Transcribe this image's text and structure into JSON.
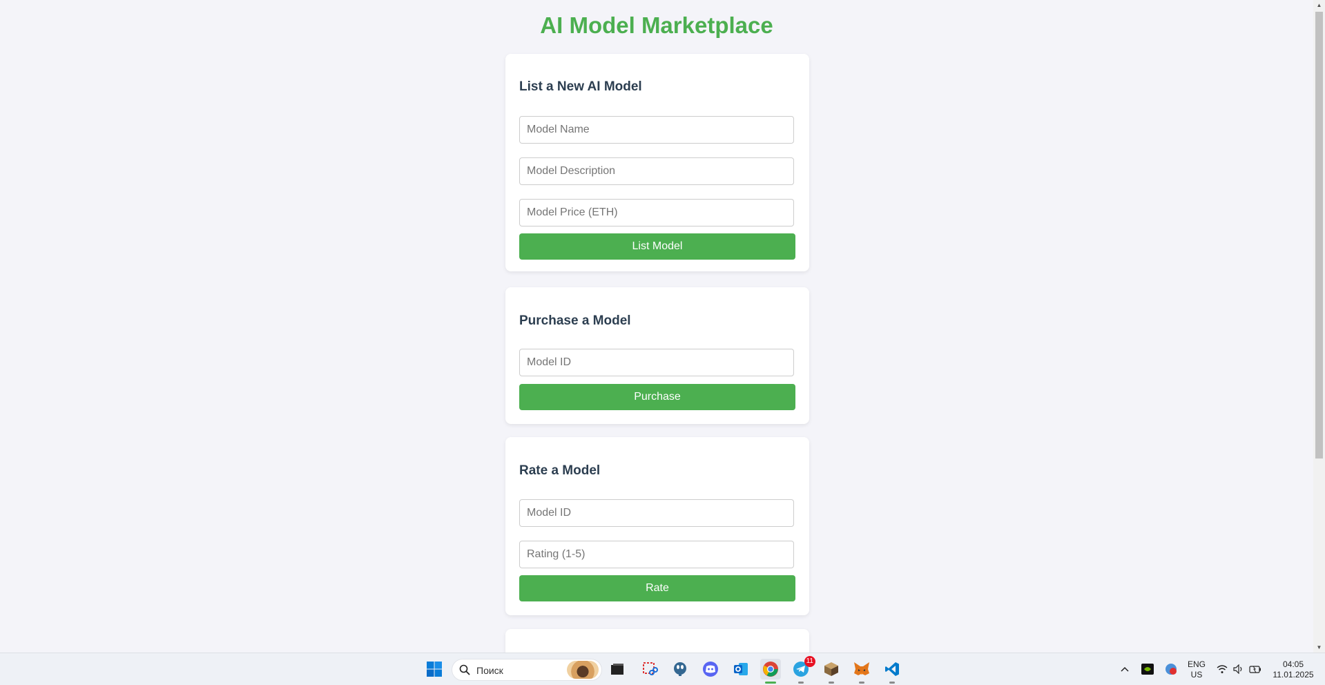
{
  "page": {
    "title": "AI Model Marketplace"
  },
  "list_card": {
    "heading": "List a New AI Model",
    "name_placeholder": "Model Name",
    "description_placeholder": "Model Description",
    "price_placeholder": "Model Price (ETH)",
    "button_label": "List Model"
  },
  "purchase_card": {
    "heading": "Purchase a Model",
    "id_placeholder": "Model ID",
    "button_label": "Purchase"
  },
  "rate_card": {
    "heading": "Rate a Model",
    "id_placeholder": "Model ID",
    "rating_placeholder": "Rating (1-5)",
    "button_label": "Rate"
  },
  "colors": {
    "accent": "#4caf50",
    "heading": "#2c3e50",
    "background": "#f4f4f9"
  },
  "taskbar": {
    "search_label": "Поиск",
    "telegram_badge": "11",
    "language": "ENG",
    "region": "US",
    "time": "04:05",
    "date": "11.01.2025",
    "apps": [
      "start-icon",
      "search-icon",
      "file-explorer-icon",
      "snipping-tool-icon",
      "postgresql-icon",
      "discord-icon",
      "outlook-icon",
      "chrome-icon",
      "telegram-icon",
      "package-icon",
      "metamask-icon",
      "vscode-icon"
    ]
  }
}
